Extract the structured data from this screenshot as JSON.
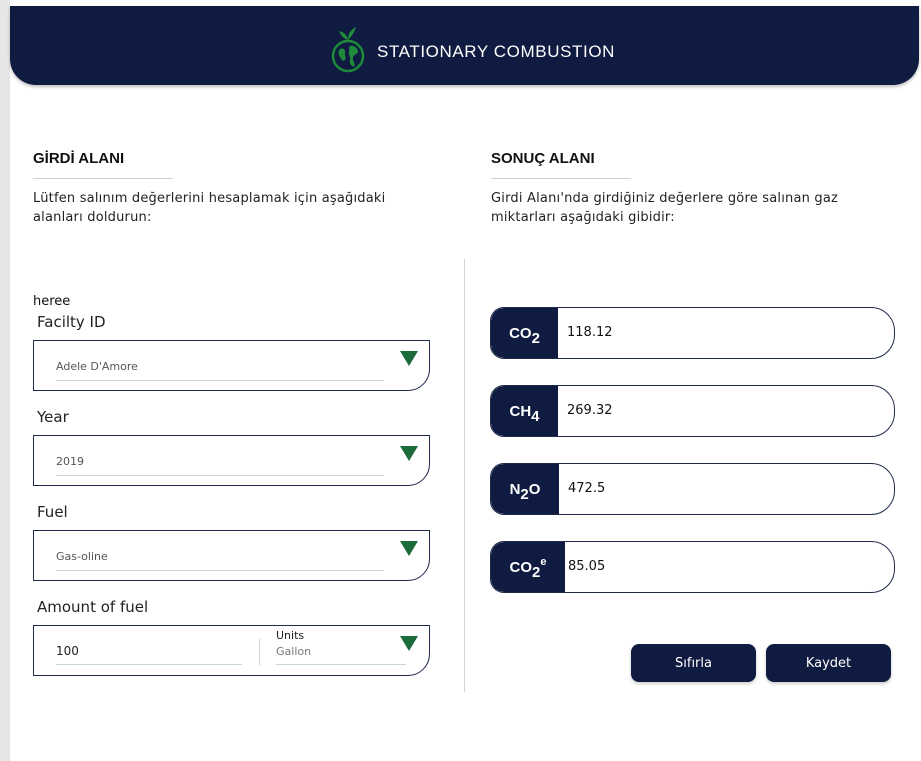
{
  "header": {
    "title": "STATIONARY COMBUSTION",
    "logo_icon": "globe-sprout-icon"
  },
  "input_section": {
    "title": "GİRDİ ALANI",
    "description": "Lütfen salınım değerlerini hesaplamak için aşağıdaki alanları doldurun:",
    "debug_text": "heree",
    "fields": {
      "facility": {
        "label": "Facilty ID",
        "value": "Adele D'Amore"
      },
      "year": {
        "label": "Year",
        "value": "2019"
      },
      "fuel": {
        "label": "Fuel",
        "value": "Gas-oline"
      },
      "amount": {
        "label": "Amount of fuel",
        "value": "100",
        "units_label": "Units",
        "units_value": "Gallon"
      }
    }
  },
  "result_section": {
    "title": "SONUÇ ALANI",
    "description": "Girdi Alanı'nda girdiğiniz değerlere göre salınan gaz miktarları aşağıdaki gibidir:",
    "results": [
      {
        "base": "CO",
        "sub": "2",
        "sup": "",
        "value": "118.12"
      },
      {
        "base": "CH",
        "sub": "4",
        "sup": "",
        "value": "269.32"
      },
      {
        "base": "N",
        "sub": "2",
        "tail": "O",
        "sup": "",
        "value": "472.5"
      },
      {
        "base": "CO",
        "sub": "2",
        "sup": "e",
        "value": "85.05"
      }
    ]
  },
  "actions": {
    "reset_label": "Sıfırla",
    "save_label": "Kaydet"
  },
  "colors": {
    "navy": "#0f1b40",
    "accent_green": "#1c6b3a"
  }
}
